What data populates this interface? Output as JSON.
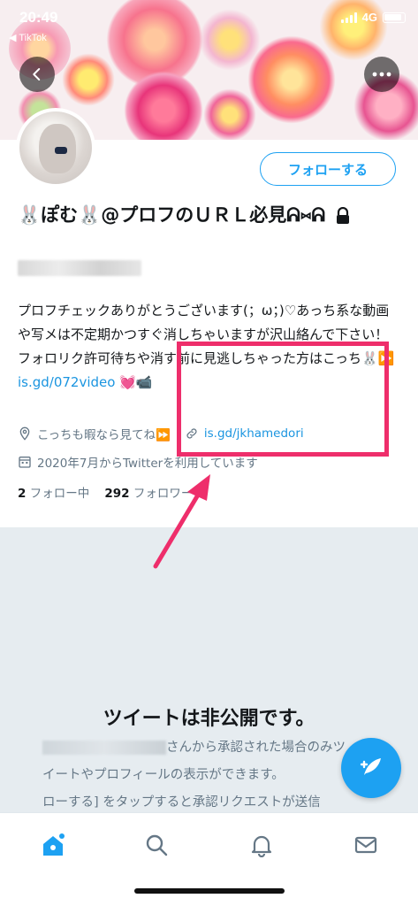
{
  "status_bar": {
    "time": "20:49",
    "back_app": "◀ TikTok",
    "network": "4G"
  },
  "profile": {
    "follow_button": "フォローする",
    "display_name": "🐰ぽむ🐰@プロフのＵＲＬ必見ᕱ⑅ᕱ",
    "bio_text": "プロフチェックありがとうございます(；ω；)♡あっち系な動画や写メは不定期かつすぐ消しちゃいますが沢山絡んで下さい！フォロリク許可待ちや消す前に見逃しちゃった方はこっち🐰⏩ ",
    "bio_link": "is.gd/072video",
    "bio_tail": " 💓📹",
    "location": "こっちも暇なら見てね⏩",
    "website": "is.gd/jkhamedori",
    "joined": "2020年7月からTwitterを利用しています",
    "following_count": "2",
    "following_label": "フォロー中",
    "followers_count": "292",
    "followers_label": "フォロワー"
  },
  "private_notice": {
    "title": "ツイートは非公開です。",
    "line1": "さんから承認された場合のみツ",
    "line2": "イートやプロフィールの表示ができます。",
    "line3": "ローする] をタップすると承認リクエストが送信"
  },
  "colors": {
    "accent": "#1da1f2",
    "link": "#1b95e0",
    "annotation": "#ee2e6b",
    "muted": "#657786"
  },
  "icons": {
    "back": "back-arrow-icon",
    "more": "more-dots-icon",
    "lock": "lock-icon",
    "location": "location-pin-icon",
    "link": "link-icon",
    "calendar": "calendar-icon",
    "compose": "compose-tweet-icon",
    "home": "home-icon",
    "search": "search-icon",
    "notifications": "bell-icon",
    "messages": "mail-icon"
  }
}
